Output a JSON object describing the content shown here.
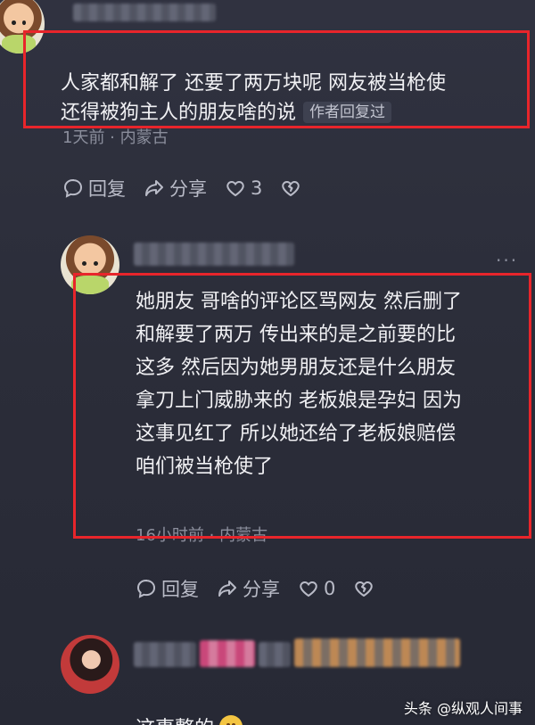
{
  "comments": [
    {
      "username": "",
      "text": "人家都和解了 还要了两万块呢 网友被当枪使\n还得被狗主人的朋友啥的说",
      "badge": "作者回复过",
      "meta": "1天前 · 内蒙古",
      "reply_label": "回复",
      "share_label": "分享",
      "like_count": "3"
    },
    {
      "username": "",
      "text": "她朋友 哥啥的评论区骂网友 然后删了\n和解要了两万 传出来的是之前要的比\n这多 然后因为她男朋友还是什么朋友\n拿刀上门威胁来的 老板娘是孕妇 因为\n这事见红了 所以她还给了老板娘赔偿\n咱们被当枪使了",
      "meta": "16小时前 · 内蒙古",
      "reply_label": "回复",
      "share_label": "分享",
      "like_count": "0",
      "more": "···"
    },
    {
      "username": "",
      "text": "这事整的",
      "emoji": "face-with-hand-over-mouth"
    }
  ],
  "watermark": "头条 @纵观人间事",
  "highlight_color": "#e8252b"
}
